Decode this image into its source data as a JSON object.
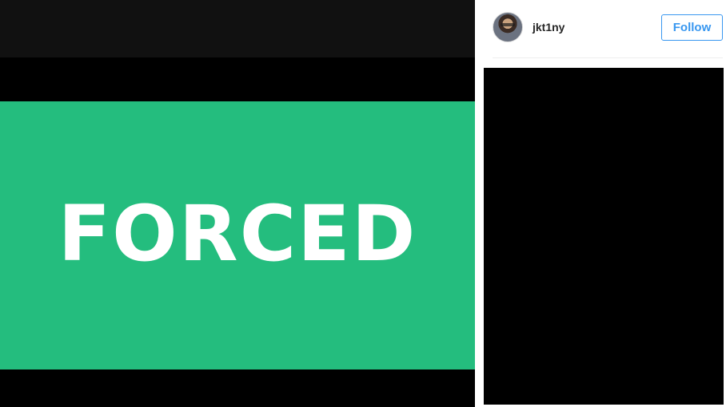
{
  "media": {
    "banner_text": "FORCED",
    "banner_color": "#24bd7e",
    "background_color": "#000000"
  },
  "panel": {
    "username": "jkt1ny",
    "avatar_icon": "user-avatar",
    "follow_label": "Follow",
    "accent_color": "#3897f0"
  }
}
